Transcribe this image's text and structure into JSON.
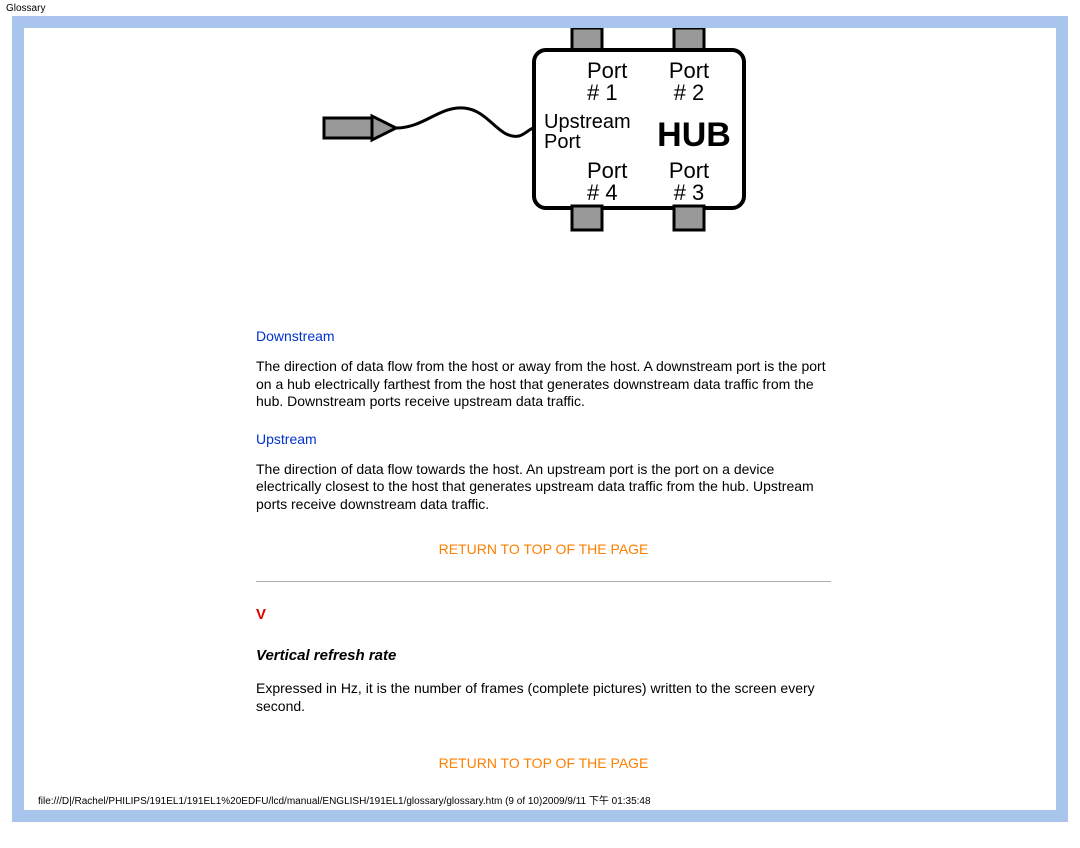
{
  "header": {
    "label": "Glossary"
  },
  "diagram": {
    "port1": "Port\n# 1",
    "port2": "Port\n# 2",
    "upstream_port": "Upstream\nPort",
    "hub": "HUB",
    "port4": "Port\n# 4",
    "port3": "Port\n# 3"
  },
  "terms": {
    "downstream_label": "Downstream",
    "downstream_body": "The direction of data flow from the host or away from the host. A downstream port is the port on a hub electrically farthest from the host that generates downstream data traffic from the hub. Downstream ports receive upstream data traffic.",
    "upstream_label": "Upstream",
    "upstream_body": "The direction of data flow towards the host. An upstream port is the port on a device electrically closest to the host that generates upstream data traffic from the hub. Upstream ports receive downstream data traffic."
  },
  "nav": {
    "return_top_1": "RETURN TO TOP OF THE PAGE",
    "return_top_2": "RETURN TO TOP OF THE PAGE"
  },
  "section_v": {
    "letter": "V",
    "term": "Vertical refresh rate",
    "body": "Expressed in Hz, it is the number of frames (complete pictures) written to the screen every second."
  },
  "footer": {
    "path": "file:///D|/Rachel/PHILIPS/191EL1/191EL1%20EDFU/lcd/manual/ENGLISH/191EL1/glossary/glossary.htm (9 of 10)2009/9/11 下午 01:35:48"
  }
}
